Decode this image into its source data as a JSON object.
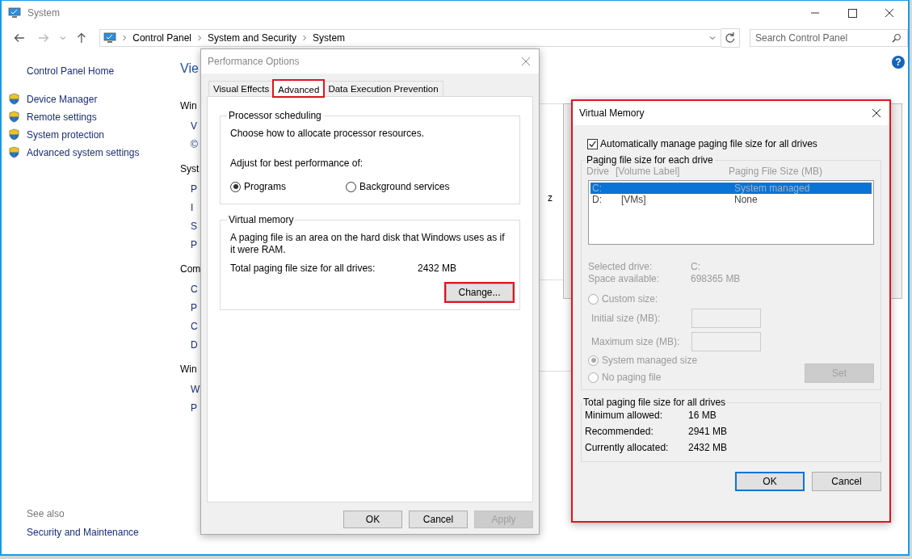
{
  "window": {
    "title": "System"
  },
  "address": {
    "path": [
      "Control Panel",
      "System and Security",
      "System"
    ]
  },
  "search": {
    "placeholder": "Search Control Panel"
  },
  "help": "?",
  "sidebar": {
    "home": "Control Panel Home",
    "items": [
      "Device Manager",
      "Remote settings",
      "System protection",
      "Advanced system settings"
    ],
    "see_also": "See also",
    "see_also_links": [
      "Security and Maintenance"
    ]
  },
  "main_fragments": [
    {
      "kind": "title",
      "text": "Vie"
    },
    {
      "kind": "heading",
      "text": "Win"
    },
    {
      "kind": "item",
      "text": "V"
    },
    {
      "kind": "item",
      "text": "©"
    },
    {
      "kind": "heading",
      "text": "Syst"
    },
    {
      "kind": "item",
      "text": "P"
    },
    {
      "kind": "item",
      "text": "I"
    },
    {
      "kind": "item",
      "text": "S"
    },
    {
      "kind": "item",
      "text": "P"
    },
    {
      "kind": "heading",
      "text": "Com"
    },
    {
      "kind": "item",
      "text": "C"
    },
    {
      "kind": "item",
      "text": "P"
    },
    {
      "kind": "item",
      "text": "C"
    },
    {
      "kind": "item",
      "text": "D"
    },
    {
      "kind": "heading",
      "text": "Win"
    },
    {
      "kind": "item",
      "text": "W"
    },
    {
      "kind": "item",
      "text": "P"
    }
  ],
  "right_fragment": "z",
  "performance_dialog": {
    "title": "Performance Options",
    "tabs": [
      {
        "label": "Visual Effects",
        "selected": false,
        "highlighted": false
      },
      {
        "label": "Advanced",
        "selected": true,
        "highlighted": true
      },
      {
        "label": "Data Execution Prevention",
        "selected": false,
        "highlighted": false
      }
    ],
    "processor_group": {
      "title": "Processor scheduling",
      "description": "Choose how to allocate processor resources.",
      "prompt": "Adjust for best performance of:",
      "options": [
        {
          "label": "Programs",
          "selected": true
        },
        {
          "label": "Background services",
          "selected": false
        }
      ]
    },
    "memory_group": {
      "title": "Virtual memory",
      "description": "A paging file is an area on the hard disk that Windows uses as if it were RAM.",
      "total_label": "Total paging file size for all drives:",
      "total_value": "2432 MB",
      "change_button": {
        "label": "Change...",
        "highlighted": true
      }
    },
    "buttons": [
      {
        "label": "OK",
        "disabled": false
      },
      {
        "label": "Cancel",
        "disabled": false
      },
      {
        "label": "Apply",
        "disabled": true
      }
    ]
  },
  "virtual_memory_dialog": {
    "title": "Virtual Memory",
    "highlighted": true,
    "auto_manage": {
      "label": "Automatically manage paging file size for all drives",
      "checked": true
    },
    "drives_group": {
      "title": "Paging file size for each drive",
      "disabled": true,
      "columns": [
        "Drive",
        "[Volume Label]",
        "Paging File Size (MB)"
      ],
      "rows": [
        {
          "drive": "C:",
          "size": "System managed",
          "selected": true
        },
        {
          "drive": "D:",
          "label": "[VMs]",
          "size": "None",
          "selected": false
        }
      ],
      "info": [
        {
          "label": "Selected drive:",
          "value": "C:"
        },
        {
          "label": "Space available:",
          "value": "698365 MB"
        }
      ],
      "size_options": [
        {
          "label": "Custom size:",
          "selected": false
        },
        {
          "label": "System managed size",
          "selected": true
        },
        {
          "label": "No paging file",
          "selected": false
        }
      ],
      "fields": [
        {
          "label": "Initial size (MB):"
        },
        {
          "label": "Maximum size (MB):"
        }
      ],
      "set_button": {
        "label": "Set",
        "disabled": true
      }
    },
    "totals_group": {
      "title": "Total paging file size for all drives",
      "rows": [
        {
          "label": "Minimum allowed:",
          "value": "16 MB"
        },
        {
          "label": "Recommended:",
          "value": "2941 MB"
        },
        {
          "label": "Currently allocated:",
          "value": "2432 MB"
        }
      ]
    },
    "buttons": [
      {
        "label": "OK",
        "default": true
      },
      {
        "label": "Cancel",
        "default": false
      }
    ]
  }
}
